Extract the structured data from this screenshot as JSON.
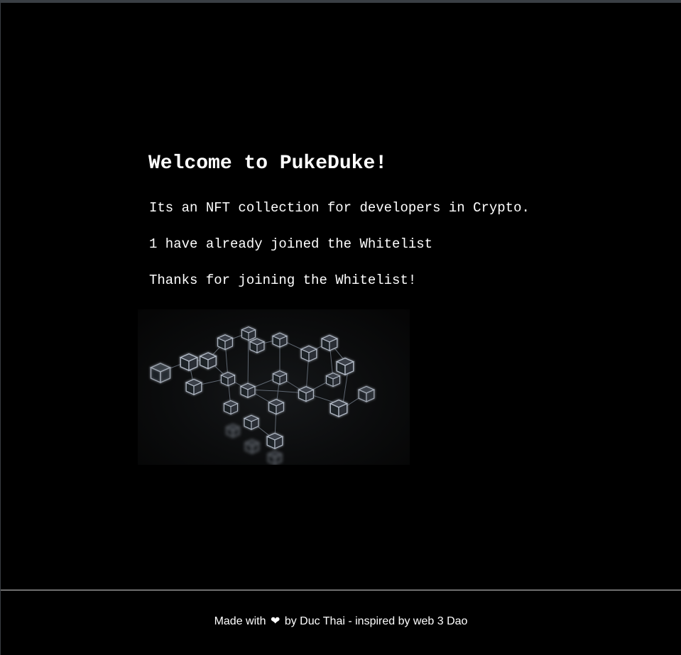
{
  "main": {
    "title": "Welcome to PukeDuke!",
    "description": "Its an NFT collection for developers in Crypto.",
    "whitelist_count_text": "1 have already joined the Whitelist",
    "status_text": "Thanks for joining the Whitelist!",
    "hero_image": {
      "icon": "blockchain-network-image"
    }
  },
  "footer": {
    "text_before": "Made with",
    "heart_glyph": "❤",
    "text_after": "by Duc Thai - inspired by web 3 Dao"
  },
  "colors": {
    "background": "#000000",
    "text": "#ffffff",
    "divider": "#d0d0d0"
  }
}
